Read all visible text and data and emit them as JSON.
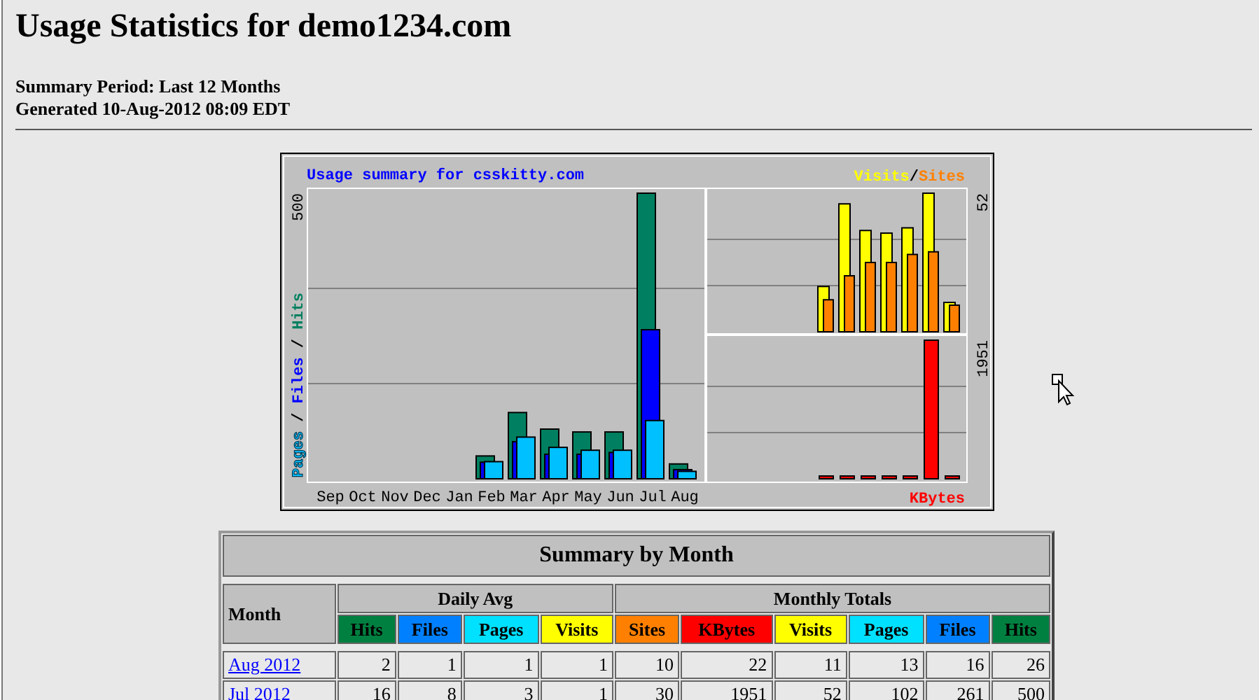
{
  "page": {
    "title": "Usage Statistics for demo1234.com",
    "summary_period": "Summary Period: Last 12 Months",
    "generated": "Generated 10-Aug-2012 08:09 EDT"
  },
  "usage_graph": {
    "title": "Usage summary for csskitty.com",
    "separator": "/",
    "left_panel": {
      "max_label": "500",
      "months": [
        "Sep",
        "Oct",
        "Nov",
        "Dec",
        "Jan",
        "Feb",
        "Mar",
        "Apr",
        "May",
        "Jun",
        "Jul",
        "Aug"
      ],
      "legend": [
        {
          "label": "Pages",
          "color": "#00c0ff"
        },
        {
          "label": "Files",
          "color": "#0000ff"
        },
        {
          "label": "Hits",
          "color": "#008060"
        }
      ]
    },
    "top_right_panel": {
      "max_label": "52",
      "legend": [
        {
          "label": "Visits",
          "color": "#ffff00"
        },
        {
          "label": "Sites",
          "color": "#ff8000"
        }
      ]
    },
    "bottom_right_panel": {
      "max_label": "1951",
      "legend": [
        {
          "label": "KBytes",
          "color": "#ff0000"
        }
      ]
    }
  },
  "summary_table": {
    "title": "Summary by Month",
    "month_header": "Month",
    "groups": [
      {
        "label": "Daily Avg",
        "columns": [
          {
            "label": "Hits",
            "color": "#008040"
          },
          {
            "label": "Files",
            "color": "#0080ff"
          },
          {
            "label": "Pages",
            "color": "#00e0ff"
          },
          {
            "label": "Visits",
            "color": "#ffff00"
          }
        ]
      },
      {
        "label": "Monthly Totals",
        "columns": [
          {
            "label": "Sites",
            "color": "#ff8000"
          },
          {
            "label": "KBytes",
            "color": "#ff0000"
          },
          {
            "label": "Visits",
            "color": "#ffff00"
          },
          {
            "label": "Pages",
            "color": "#00e0ff"
          },
          {
            "label": "Files",
            "color": "#0080ff"
          },
          {
            "label": "Hits",
            "color": "#008040"
          }
        ]
      }
    ],
    "rows": [
      {
        "month": "Aug 2012",
        "values": [
          "2",
          "1",
          "1",
          "1",
          "10",
          "22",
          "11",
          "13",
          "16",
          "26"
        ]
      },
      {
        "month": "Jul 2012",
        "values": [
          "16",
          "8",
          "3",
          "1",
          "30",
          "1951",
          "52",
          "102",
          "261",
          "500"
        ]
      }
    ]
  }
}
